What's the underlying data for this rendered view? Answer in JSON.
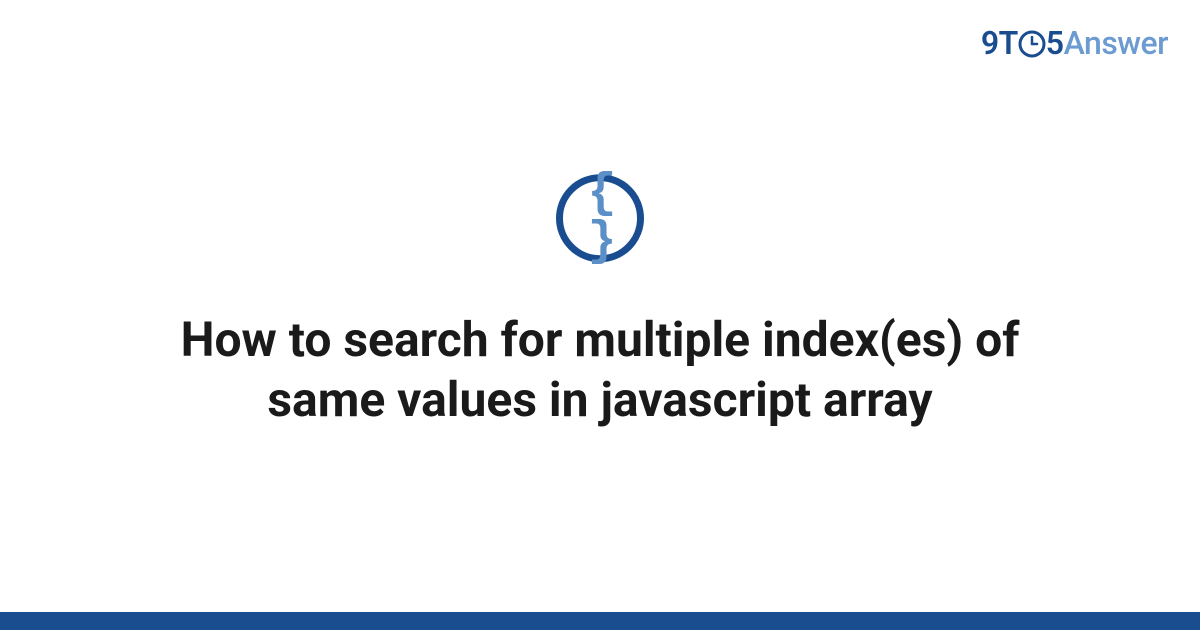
{
  "logo": {
    "part1": "9T",
    "part2": "5",
    "part3": "Answer"
  },
  "icon": {
    "name": "braces-icon",
    "glyph": "{ }"
  },
  "title": "How to search for multiple index(es) of same values in javascript array",
  "colors": {
    "primary": "#1a4d8f",
    "secondary": "#6b9bd1",
    "accent": "#5b8fc7"
  }
}
